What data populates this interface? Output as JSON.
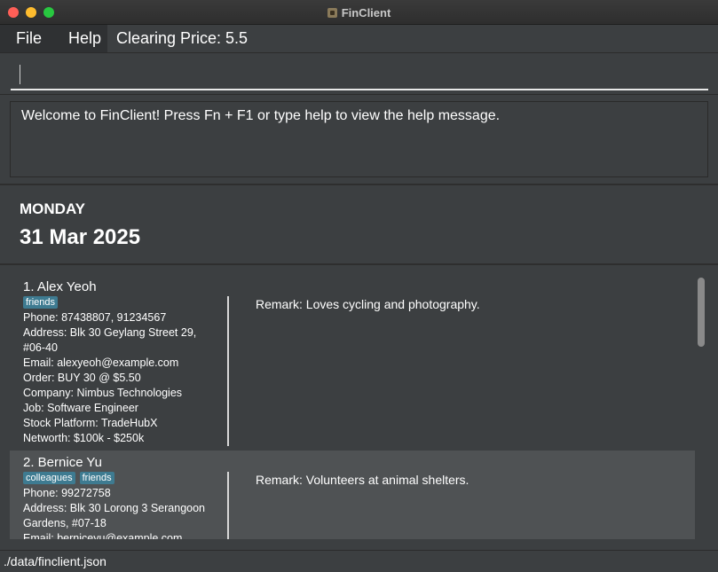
{
  "window": {
    "title": "FinClient"
  },
  "menu": {
    "file": "File",
    "help": "Help",
    "clearing_price": "Clearing Price: 5.5"
  },
  "command": {
    "value": "",
    "placeholder": ""
  },
  "result": {
    "message": "Welcome to FinClient! Press Fn + F1 or type help to view the help message."
  },
  "date_panel": {
    "day": "MONDAY",
    "date": "31 Mar 2025"
  },
  "persons": [
    {
      "name": "1. Alex Yeoh",
      "tags": [
        "friends"
      ],
      "phone": "Phone: 87438807, 91234567",
      "address_line1": "Address: Blk 30 Geylang Street 29,",
      "address_line2": "#06-40",
      "email": "Email: alexyeoh@example.com",
      "order": "Order: BUY 30 @ $5.50",
      "company": "Company: Nimbus Technologies",
      "job": "Job: Software Engineer",
      "platform": "Stock Platform: TradeHubX",
      "networth": "Networth: $100k - $250k",
      "remark": "Remark: Loves cycling and photography."
    },
    {
      "name": "2. Bernice Yu",
      "tags": [
        "colleagues",
        "friends"
      ],
      "phone": "Phone: 99272758",
      "address_line1": "Address: Blk 30 Lorong 3 Serangoon",
      "address_line2": "Gardens, #07-18",
      "email": "Email: berniceyu@example.com",
      "remark": "Remark: Volunteers at animal shelters."
    }
  ],
  "status": {
    "path": "./data/finclient.json"
  }
}
